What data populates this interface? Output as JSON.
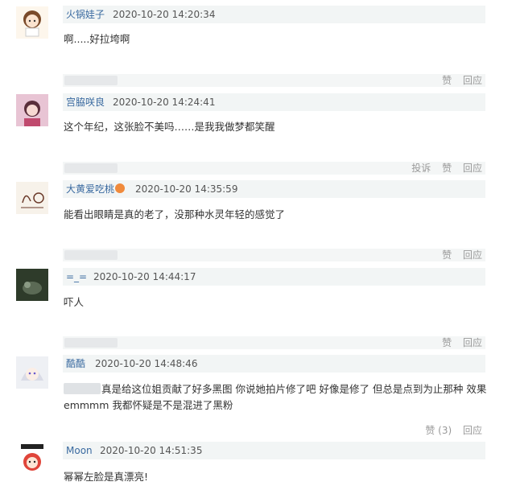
{
  "comments": [
    {
      "username": "火锅娃子",
      "time": "2020-10-20 14:20:34",
      "text": "啊.....好拉垮啊",
      "actions": [
        "赞",
        "回应"
      ]
    },
    {
      "username": "宫脇咲良",
      "time": "2020-10-20 14:24:41",
      "text": "这个年纪，这张脸不美吗……是我我做梦都笑醒",
      "actions": [
        "投诉",
        "赞",
        "回应"
      ]
    },
    {
      "username": "大黄爱吃桃",
      "time": "2020-10-20 14:35:59",
      "text": "能看出眼睛是真的老了，没那种水灵年轻的感觉了",
      "actions": [
        "赞",
        "回应"
      ]
    },
    {
      "username": "=_=",
      "time": "2020-10-20 14:44:17",
      "text": "吓人",
      "actions": [
        "赞",
        "回应"
      ]
    },
    {
      "username": "酷酷",
      "time": "2020-10-20 14:48:46",
      "text": "真是给这位姐贡献了好多黑图 你说她拍片修了吧 好像是修了 但总是点到为止那种 效果emmmm 我都怀疑是不是混进了黑粉",
      "actions": [
        "赞 (3)",
        "回应"
      ]
    },
    {
      "username": "Moon",
      "time": "2020-10-20 14:51:35",
      "text": "幂幂左脸是真漂亮!",
      "actions": []
    }
  ],
  "colors": {
    "username": "#3a6aa0",
    "meta_bar_bg": "#f2f5f5",
    "action_text": "#999999"
  }
}
